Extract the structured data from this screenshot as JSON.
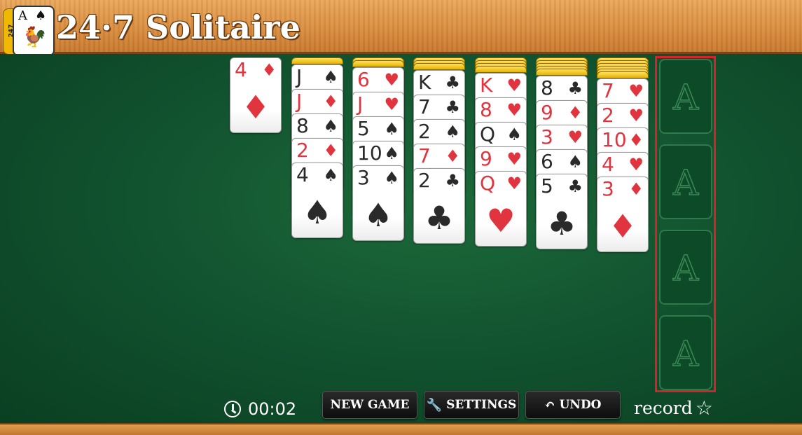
{
  "header": {
    "title": "24·7 Solitaire",
    "logo": {
      "stack_text": "247",
      "rank": "A",
      "suit": "♠",
      "emblem_icon": "rooster-icon"
    }
  },
  "waste": {
    "rank": "4",
    "suit": "♦",
    "color": "red"
  },
  "tableau": [
    {
      "hidden_cards": 1,
      "cards": [
        {
          "rank": "J",
          "suit": "♠",
          "color": "black"
        },
        {
          "rank": "J",
          "suit": "♦",
          "color": "red"
        },
        {
          "rank": "8",
          "suit": "♠",
          "color": "black"
        },
        {
          "rank": "2",
          "suit": "♦",
          "color": "red"
        },
        {
          "rank": "4",
          "suit": "♠",
          "color": "black"
        }
      ]
    },
    {
      "hidden_cards": 2,
      "cards": [
        {
          "rank": "6",
          "suit": "♥",
          "color": "red"
        },
        {
          "rank": "J",
          "suit": "♥",
          "color": "red"
        },
        {
          "rank": "5",
          "suit": "♠",
          "color": "black"
        },
        {
          "rank": "10",
          "suit": "♠",
          "color": "black"
        },
        {
          "rank": "3",
          "suit": "♠",
          "color": "black"
        }
      ]
    },
    {
      "hidden_cards": 3,
      "cards": [
        {
          "rank": "K",
          "suit": "♣",
          "color": "black"
        },
        {
          "rank": "7",
          "suit": "♣",
          "color": "black"
        },
        {
          "rank": "2",
          "suit": "♠",
          "color": "black"
        },
        {
          "rank": "7",
          "suit": "♦",
          "color": "red"
        },
        {
          "rank": "2",
          "suit": "♣",
          "color": "black"
        }
      ]
    },
    {
      "hidden_cards": 4,
      "cards": [
        {
          "rank": "K",
          "suit": "♥",
          "color": "red"
        },
        {
          "rank": "8",
          "suit": "♥",
          "color": "red"
        },
        {
          "rank": "Q",
          "suit": "♠",
          "color": "black"
        },
        {
          "rank": "9",
          "suit": "♥",
          "color": "red"
        },
        {
          "rank": "Q",
          "suit": "♥",
          "color": "red"
        }
      ]
    },
    {
      "hidden_cards": 5,
      "cards": [
        {
          "rank": "8",
          "suit": "♣",
          "color": "black"
        },
        {
          "rank": "9",
          "suit": "♦",
          "color": "red"
        },
        {
          "rank": "3",
          "suit": "♥",
          "color": "red"
        },
        {
          "rank": "6",
          "suit": "♠",
          "color": "black"
        },
        {
          "rank": "5",
          "suit": "♣",
          "color": "black"
        }
      ]
    },
    {
      "hidden_cards": 6,
      "cards": [
        {
          "rank": "7",
          "suit": "♥",
          "color": "red"
        },
        {
          "rank": "2",
          "suit": "♥",
          "color": "red"
        },
        {
          "rank": "10",
          "suit": "♦",
          "color": "red"
        },
        {
          "rank": "4",
          "suit": "♥",
          "color": "red"
        },
        {
          "rank": "3",
          "suit": "♦",
          "color": "red"
        }
      ]
    }
  ],
  "foundations": [
    {
      "label": "A"
    },
    {
      "label": "A"
    },
    {
      "label": "A"
    },
    {
      "label": "A"
    }
  ],
  "controls": {
    "timer": "00:02",
    "new_game": "NEW GAME",
    "settings": "SETTINGS",
    "undo": "UNDO",
    "record": "record"
  },
  "colors": {
    "felt": "#125430",
    "red_suit": "#e0343e",
    "highlight": "#d8222a",
    "card_back": "#f0c000"
  }
}
